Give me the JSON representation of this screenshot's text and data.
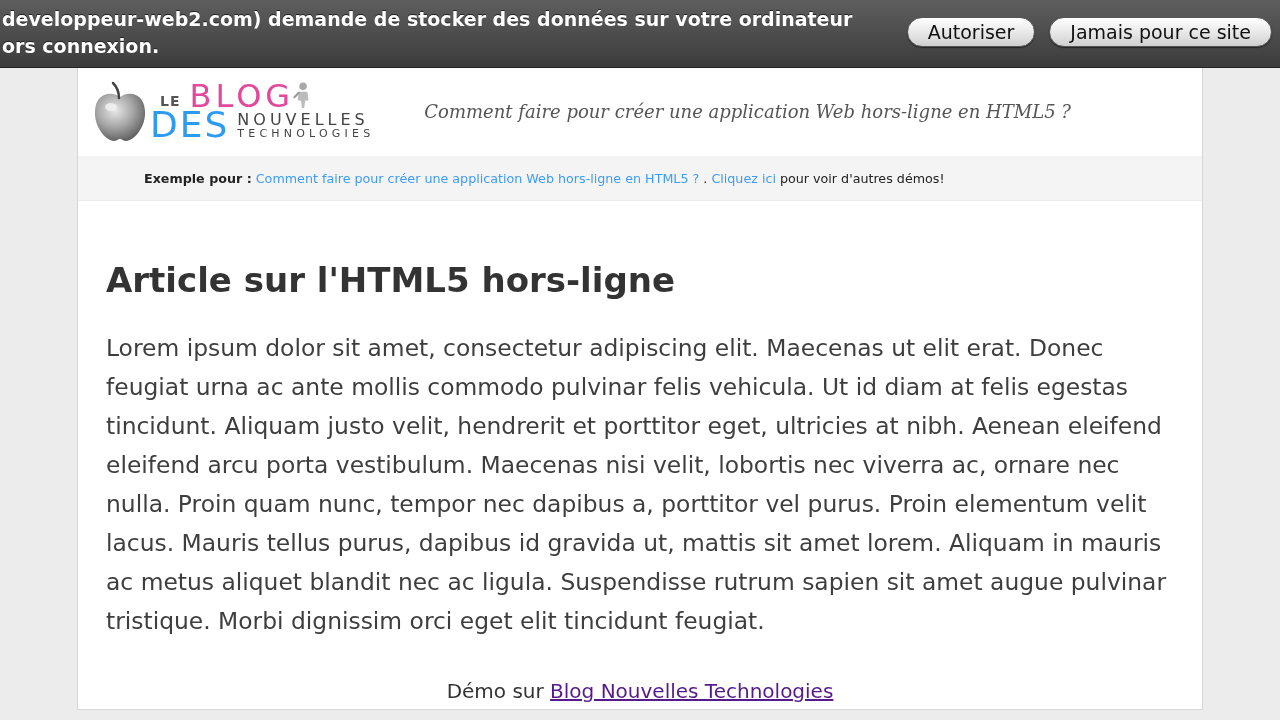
{
  "notification": {
    "message_lines": [
      "developpeur-web2.com) demande de stocker des données sur votre ordinateur",
      "ors connexion."
    ],
    "buttons": [
      "Autoriser",
      "Jamais pour ce site"
    ]
  },
  "header": {
    "logo": {
      "small": "LE",
      "blog": "BLOG",
      "des": "DES",
      "nouvelles": "NOUVELLES",
      "technologies": "TECHNOLOGIES"
    },
    "tagline": "Comment faire pour créer une application Web hors-ligne en HTML5 ?"
  },
  "example_bar": {
    "label": "Exemple pour :",
    "article_link": "Comment faire pour créer une application Web hors-ligne en HTML5 ?",
    "separator": ".",
    "demos_link": "Cliquez ici",
    "tail": "pour voir d'autres démos!"
  },
  "article": {
    "title": "Article sur l'HTML5 hors-ligne",
    "body": "Lorem ipsum dolor sit amet, consectetur adipiscing elit. Maecenas ut elit erat. Donec feugiat urna ac ante mollis commodo pulvinar felis vehicula. Ut id diam at felis egestas tincidunt. Aliquam justo velit, hendrerit et porttitor eget, ultricies at nibh. Aenean eleifend eleifend arcu porta vestibulum. Maecenas nisi velit, lobortis nec viverra ac, ornare nec nulla. Proin quam nunc, tempor nec dapibus a, porttitor vel purus. Proin elementum velit lacus. Mauris tellus purus, dapibus id gravida ut, mattis sit amet lorem. Aliquam in mauris ac metus aliquet blandit nec ac ligula. Suspendisse rutrum sapien sit amet augue pulvinar tristique. Morbi dignissim orci eget elit tincidunt feugiat."
  },
  "footer": {
    "prefix": "Démo sur",
    "link": "Blog Nouvelles Technologies"
  }
}
